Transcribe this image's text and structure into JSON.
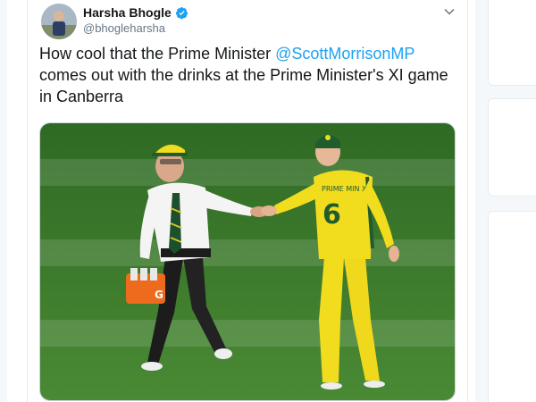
{
  "author": {
    "display_name": "Harsha Bhogle",
    "handle": "@bhogleharsha",
    "verified": true
  },
  "tweet": {
    "text_before": "How cool that the Prime Minister ",
    "mention": "@ScottMorrisonMP",
    "text_after": " comes out with the drinks at the Prime Minister's XI game in Canberra"
  },
  "media": {
    "type": "photo",
    "shirt_number": "6",
    "shirt_text": "PRIME MIN XI"
  },
  "icons": {
    "verified": "verified-badge-icon",
    "caret": "chevron-down-icon"
  },
  "colors": {
    "link": "#1da1f2",
    "verified": "#1da1f2",
    "pitch": "#3c7a2c",
    "jersey": "#f2dc1e",
    "cap": "#1f5c2e"
  }
}
